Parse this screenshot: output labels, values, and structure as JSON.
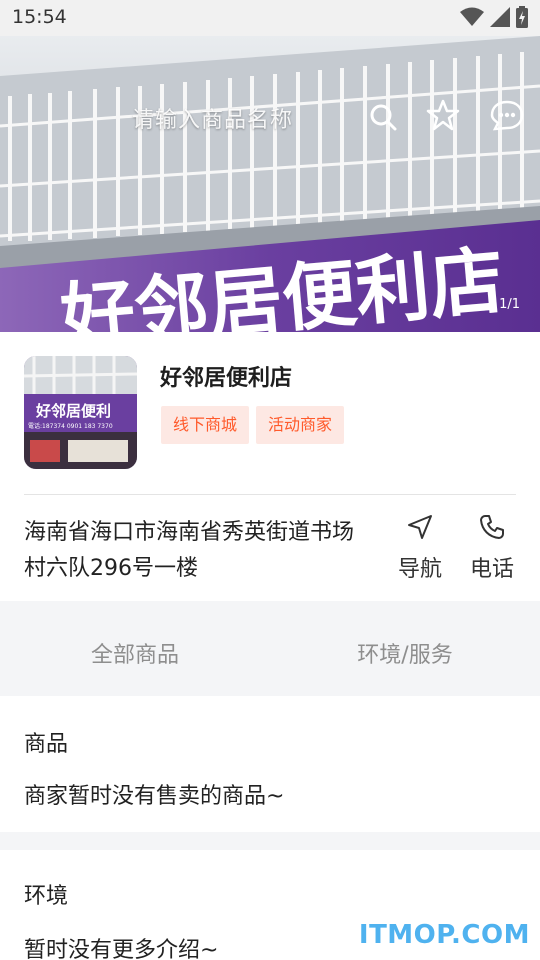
{
  "status_bar": {
    "time": "15:54"
  },
  "hero": {
    "search_placeholder": "请输入商品名称",
    "sign_text": "好邻居便利店",
    "page_indicator": "1/1"
  },
  "shop": {
    "name": "好邻居便利店",
    "tags": [
      "线下商城",
      "活动商家"
    ],
    "thumb_sign": "好邻居便利",
    "thumb_phone": "電话:187374 0901  183 7370"
  },
  "address": {
    "text": "海南省海口市海南省秀英街道书场村六队296号一楼",
    "navigate_label": "导航",
    "phone_label": "电话"
  },
  "tabs": [
    "全部商品",
    "环境/服务"
  ],
  "goods_section": {
    "title": "商品",
    "empty_text": "商家暂时没有售卖的商品~"
  },
  "env_section": {
    "title": "环境",
    "empty_text": "暂时没有更多介绍~"
  },
  "watermark": "ITMOP.COM",
  "colors": {
    "tag_text": "#ff5a2b",
    "tag_bg": "#fde8e3",
    "banner_purple": "#6a3fa0",
    "watermark": "#4fb2ef"
  }
}
